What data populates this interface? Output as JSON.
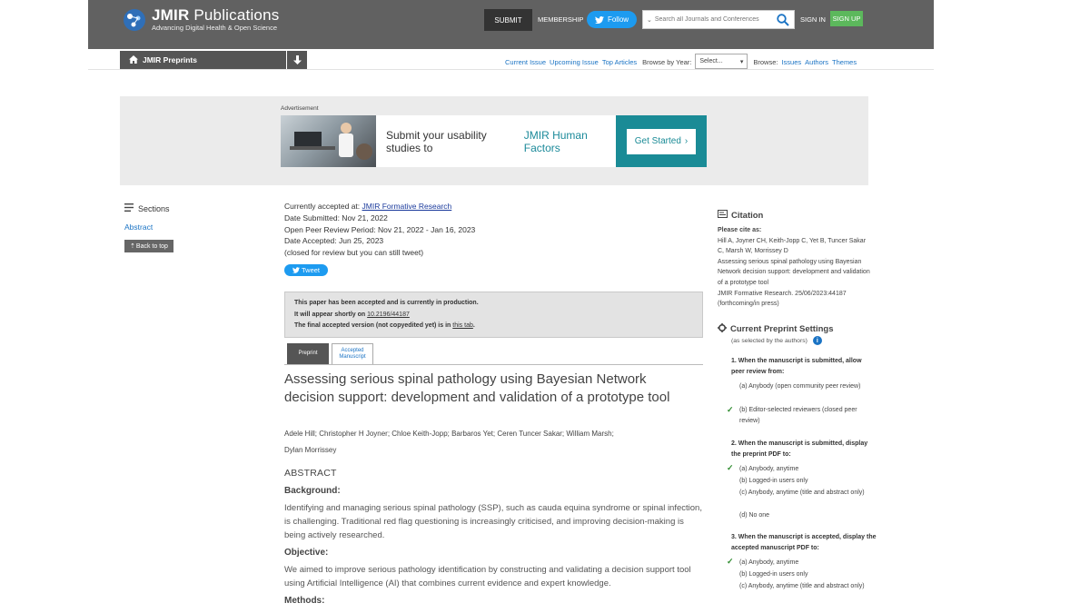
{
  "header": {
    "brand": "JMIR",
    "brand_rest": "Publications",
    "tagline": "Advancing Digital Health & Open Science",
    "submit_label": "SUBMIT",
    "membership_label": "MEMBERSHIP",
    "follow_label": "Follow",
    "search_placeholder": "Search all Journals and Conferences",
    "signin_label": "SIGN IN",
    "signup_label": "SIGN UP"
  },
  "nav": {
    "section_title": "JMIR Preprints",
    "links": [
      "Current Issue",
      "Upcoming Issue",
      "Top Articles"
    ],
    "browse_year_label": "Browse by Year:",
    "year_select_value": "Select...",
    "browse_label": "Browse:",
    "browse_links": [
      "Issues",
      "Authors",
      "Themes"
    ]
  },
  "ad": {
    "label": "Advertisement",
    "text": "Submit your usability studies to",
    "highlight": "JMIR Human Factors",
    "cta": "Get Started"
  },
  "sidebar": {
    "sections_label": "Sections",
    "abstract_link": "Abstract",
    "back_top": "Back to top"
  },
  "meta": {
    "accepted_prefix": "Currently accepted at:",
    "journal": "JMIR Formative Research",
    "submitted": "Date Submitted: Nov 21, 2022",
    "review_period": "Open Peer Review Period: Nov 21, 2022 - Jan 16, 2023",
    "accepted": "Date Accepted: Jun 25, 2023",
    "closed": "(closed for review but you can still tweet)"
  },
  "tweet_label": "Tweet",
  "notice": {
    "line1": "This paper has been accepted and is currently in production.",
    "line2_prefix": "It will appear shortly on",
    "doi": "10.2196/44187",
    "line3_prefix": "The final accepted version (not copyedited yet) is in",
    "tab_link": "this tab",
    "line3_suffix": "."
  },
  "tabs": {
    "preprint": "Preprint",
    "accepted": "Accepted Manuscript"
  },
  "article": {
    "title": "Assessing serious spinal pathology using Bayesian Network decision support: development and validation of a prototype tool",
    "authors_line1": "Adele Hill;  Christopher H Joyner;  Chloe Keith-Jopp;  Barbaros Yet;  Ceren Tuncer Sakar;  William Marsh;",
    "authors_line2": "Dylan Morrissey",
    "abstract_heading": "ABSTRACT",
    "background_h": "Background:",
    "background": "Identifying and managing serious spinal pathology (SSP), such as cauda equina syndrome or spinal infection, is challenging. Traditional red flag questioning is increasingly criticised, and improving decision-making is being actively researched.",
    "objective_h": "Objective:",
    "objective": "We aimed to improve serious pathology identification by constructing and validating a decision support tool using Artificial Intelligence (AI) that combines current evidence and expert knowledge.",
    "methods_h": "Methods:"
  },
  "citation": {
    "heading": "Citation",
    "please_cite": "Please cite as:",
    "authors": "Hill A, Joyner CH, Keith-Jopp C, Yet B, Tuncer Sakar C, Marsh W, Morrissey D",
    "title": "Assessing serious spinal pathology using Bayesian Network decision support: development and validation of a prototype tool",
    "source": "JMIR Formative Research. 25/06/2023:44187 (forthcoming/in press)"
  },
  "settings": {
    "heading": "Current Preprint Settings",
    "sub": "(as selected by the authors)",
    "q1": "1. When the manuscript is submitted, allow peer review from:",
    "q1_opts": [
      "(a) Anybody (open community peer review)",
      "(b) Editor-selected reviewers (closed peer review)"
    ],
    "q2": "2. When the manuscript is submitted, display the preprint PDF to:",
    "q2_opts": [
      "(a) Anybody, anytime",
      "(b) Logged-in users only",
      "(c) Anybody, anytime (title and abstract only)",
      "(d) No one"
    ],
    "q3": "3. When the manuscript is accepted, display the accepted manuscript PDF to:",
    "q3_opts": [
      "(a) Anybody, anytime",
      "(b) Logged-in users only",
      "(c) Anybody, anytime (title and abstract only)"
    ]
  },
  "colors": {
    "header_bg": "#616161",
    "link": "#1a73c4",
    "twitter": "#1d9bf0",
    "signup": "#5cb85c",
    "ad_teal": "#1a8b96",
    "check": "#2e8b2e"
  }
}
